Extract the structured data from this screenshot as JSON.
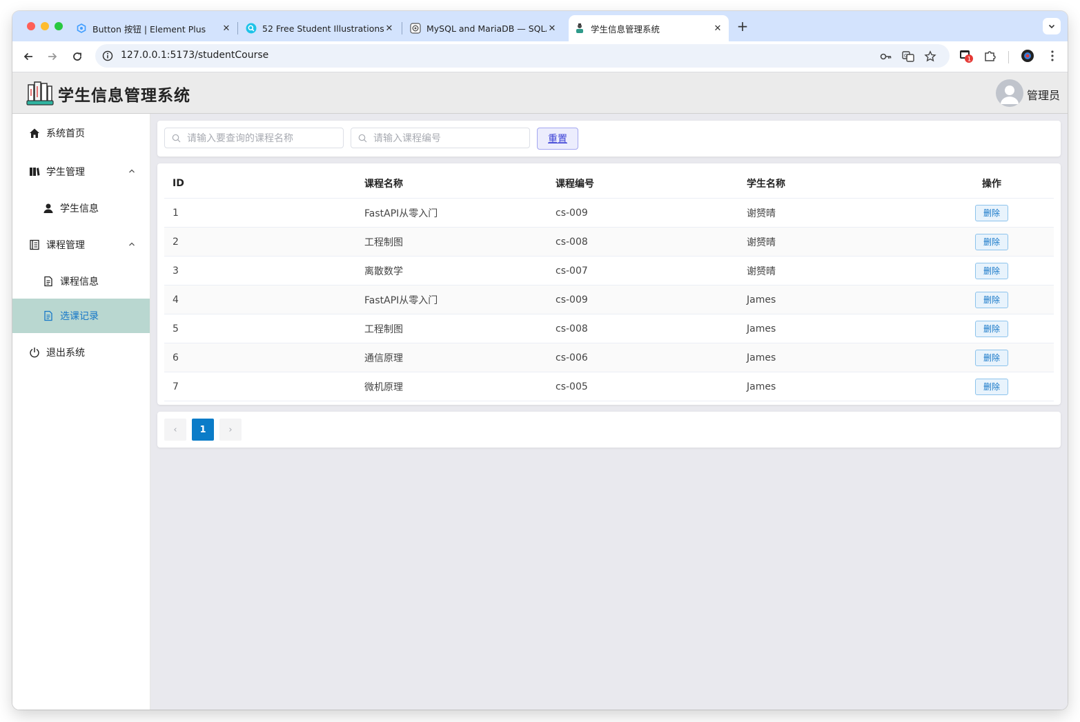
{
  "browser": {
    "tabs": [
      {
        "title": "Button 按钮 | Element Plus",
        "icon": "element-plus-icon",
        "active": false
      },
      {
        "title": "52 Free Student Illustrations - ",
        "icon": "search-icon",
        "active": false
      },
      {
        "title": "MySQL and MariaDB — SQLA",
        "icon": "sqlalchemy-icon",
        "active": false
      },
      {
        "title": "学生信息管理系统",
        "icon": "student-icon",
        "active": true
      }
    ],
    "new_tab": "+",
    "url": "127.0.0.1:5173/studentCourse",
    "extension_badge": "1"
  },
  "app": {
    "title": "学生信息管理系统",
    "user": "管理员"
  },
  "sidebar": {
    "items": [
      {
        "label": "系统首页",
        "icon": "home-icon"
      },
      {
        "label": "学生管理",
        "icon": "book-icon",
        "expanded": true
      },
      {
        "label": "学生信息",
        "icon": "person-icon"
      },
      {
        "label": "课程管理",
        "icon": "notebook-icon",
        "expanded": true
      },
      {
        "label": "课程信息",
        "icon": "document-icon"
      },
      {
        "label": "选课记录",
        "icon": "document-icon",
        "active": true
      },
      {
        "label": "退出系统",
        "icon": "power-icon"
      }
    ]
  },
  "search": {
    "course_name_placeholder": "请输入要查询的课程名称",
    "course_no_placeholder": "请输入课程编号",
    "reset_label": "重置"
  },
  "table": {
    "columns": [
      "ID",
      "课程名称",
      "课程编号",
      "学生名称",
      "操作"
    ],
    "rows": [
      {
        "id": "1",
        "course": "FastAPI从零入门",
        "code": "cs-009",
        "student": "谢赟晴"
      },
      {
        "id": "2",
        "course": "工程制图",
        "code": "cs-008",
        "student": "谢赟晴"
      },
      {
        "id": "3",
        "course": "离散数学",
        "code": "cs-007",
        "student": "谢赟晴"
      },
      {
        "id": "4",
        "course": "FastAPI从零入门",
        "code": "cs-009",
        "student": "James"
      },
      {
        "id": "5",
        "course": "工程制图",
        "code": "cs-008",
        "student": "James"
      },
      {
        "id": "6",
        "course": "通信原理",
        "code": "cs-006",
        "student": "James"
      },
      {
        "id": "7",
        "course": "微机原理",
        "code": "cs-005",
        "student": "James"
      }
    ],
    "delete_label": "删除"
  },
  "pagination": {
    "current_page": "1",
    "prev": "‹",
    "next": "›"
  },
  "colors": {
    "accent": "#1677c8",
    "active_menu_bg": "#b9d7d0",
    "page_active": "#0b7cc8"
  }
}
